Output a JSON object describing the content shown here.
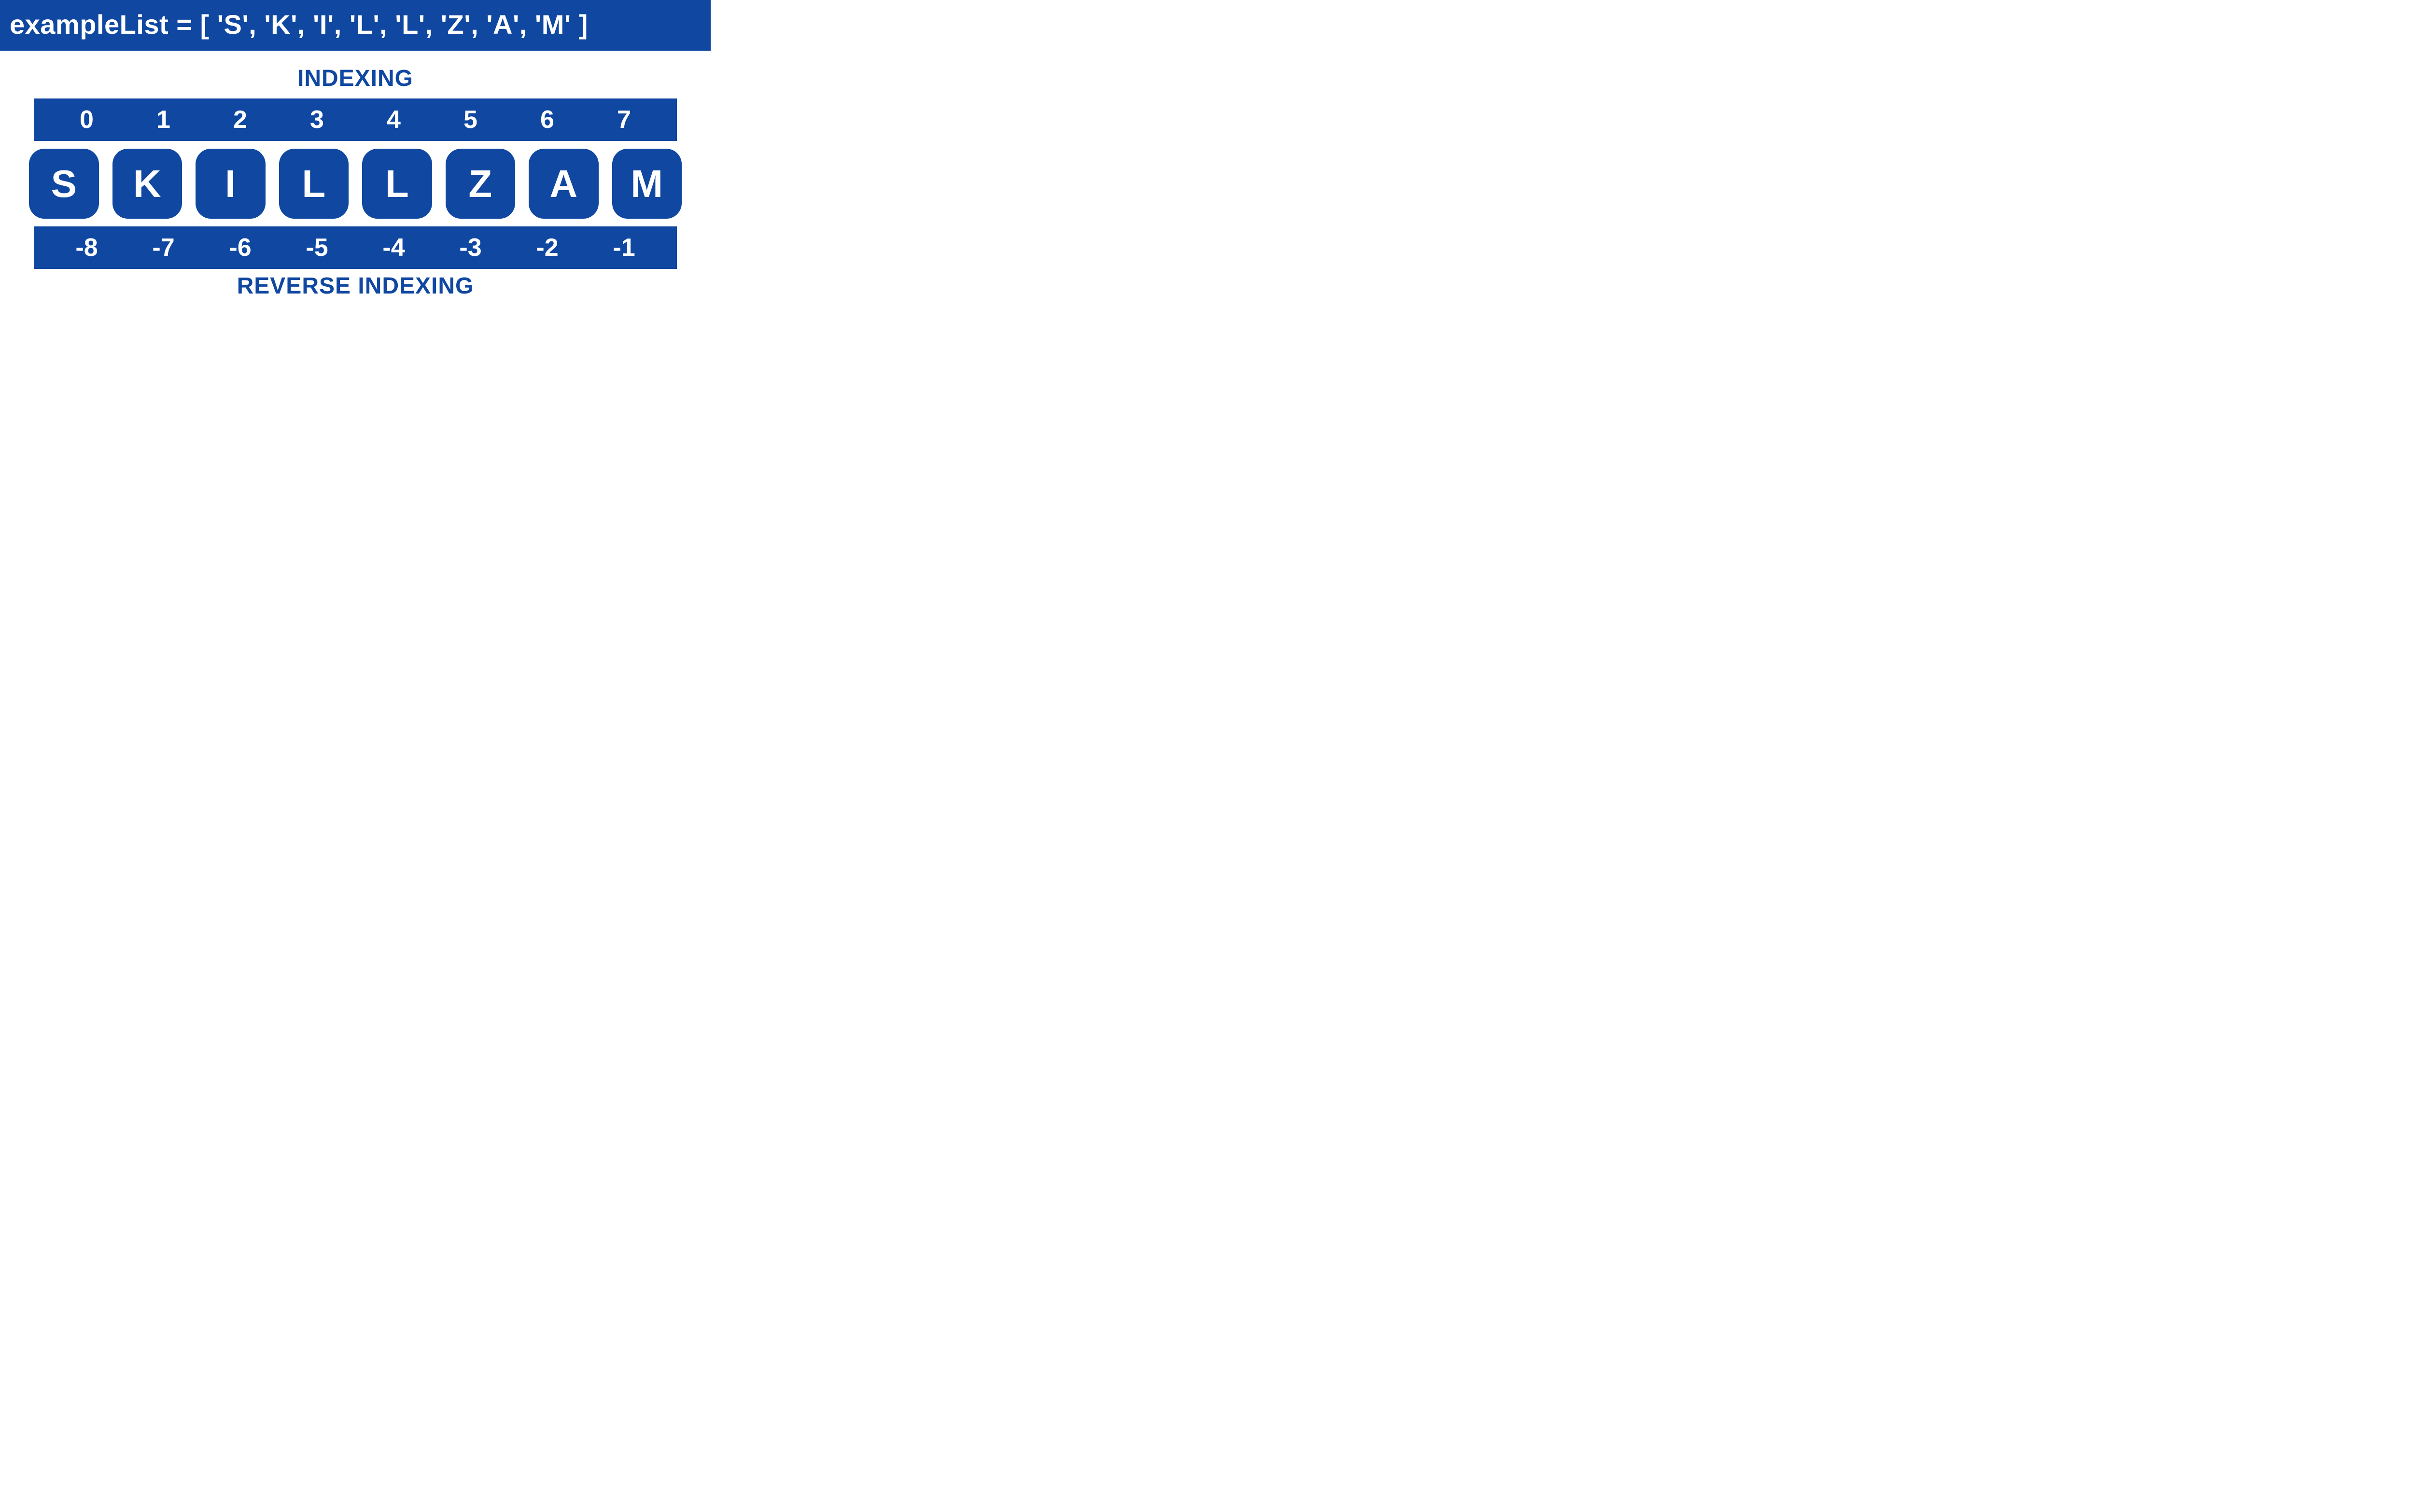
{
  "code_line": "exampleList = [ 'S', 'K', 'I', 'L', 'L', 'Z', 'A', 'M' ]",
  "titles": {
    "top": "INDEXING",
    "bottom": "REVERSE INDEXING"
  },
  "positive_indices": [
    "0",
    "1",
    "2",
    "3",
    "4",
    "5",
    "6",
    "7"
  ],
  "letters": [
    "S",
    "K",
    "I",
    "L",
    "L",
    "Z",
    "A",
    "M"
  ],
  "negative_indices": [
    "-8",
    "-7",
    "-6",
    "-5",
    "-4",
    "-3",
    "-2",
    "-1"
  ],
  "colors": {
    "primary": "#0f47a1",
    "text_on_primary": "#ffffff",
    "background": "#ffffff"
  }
}
